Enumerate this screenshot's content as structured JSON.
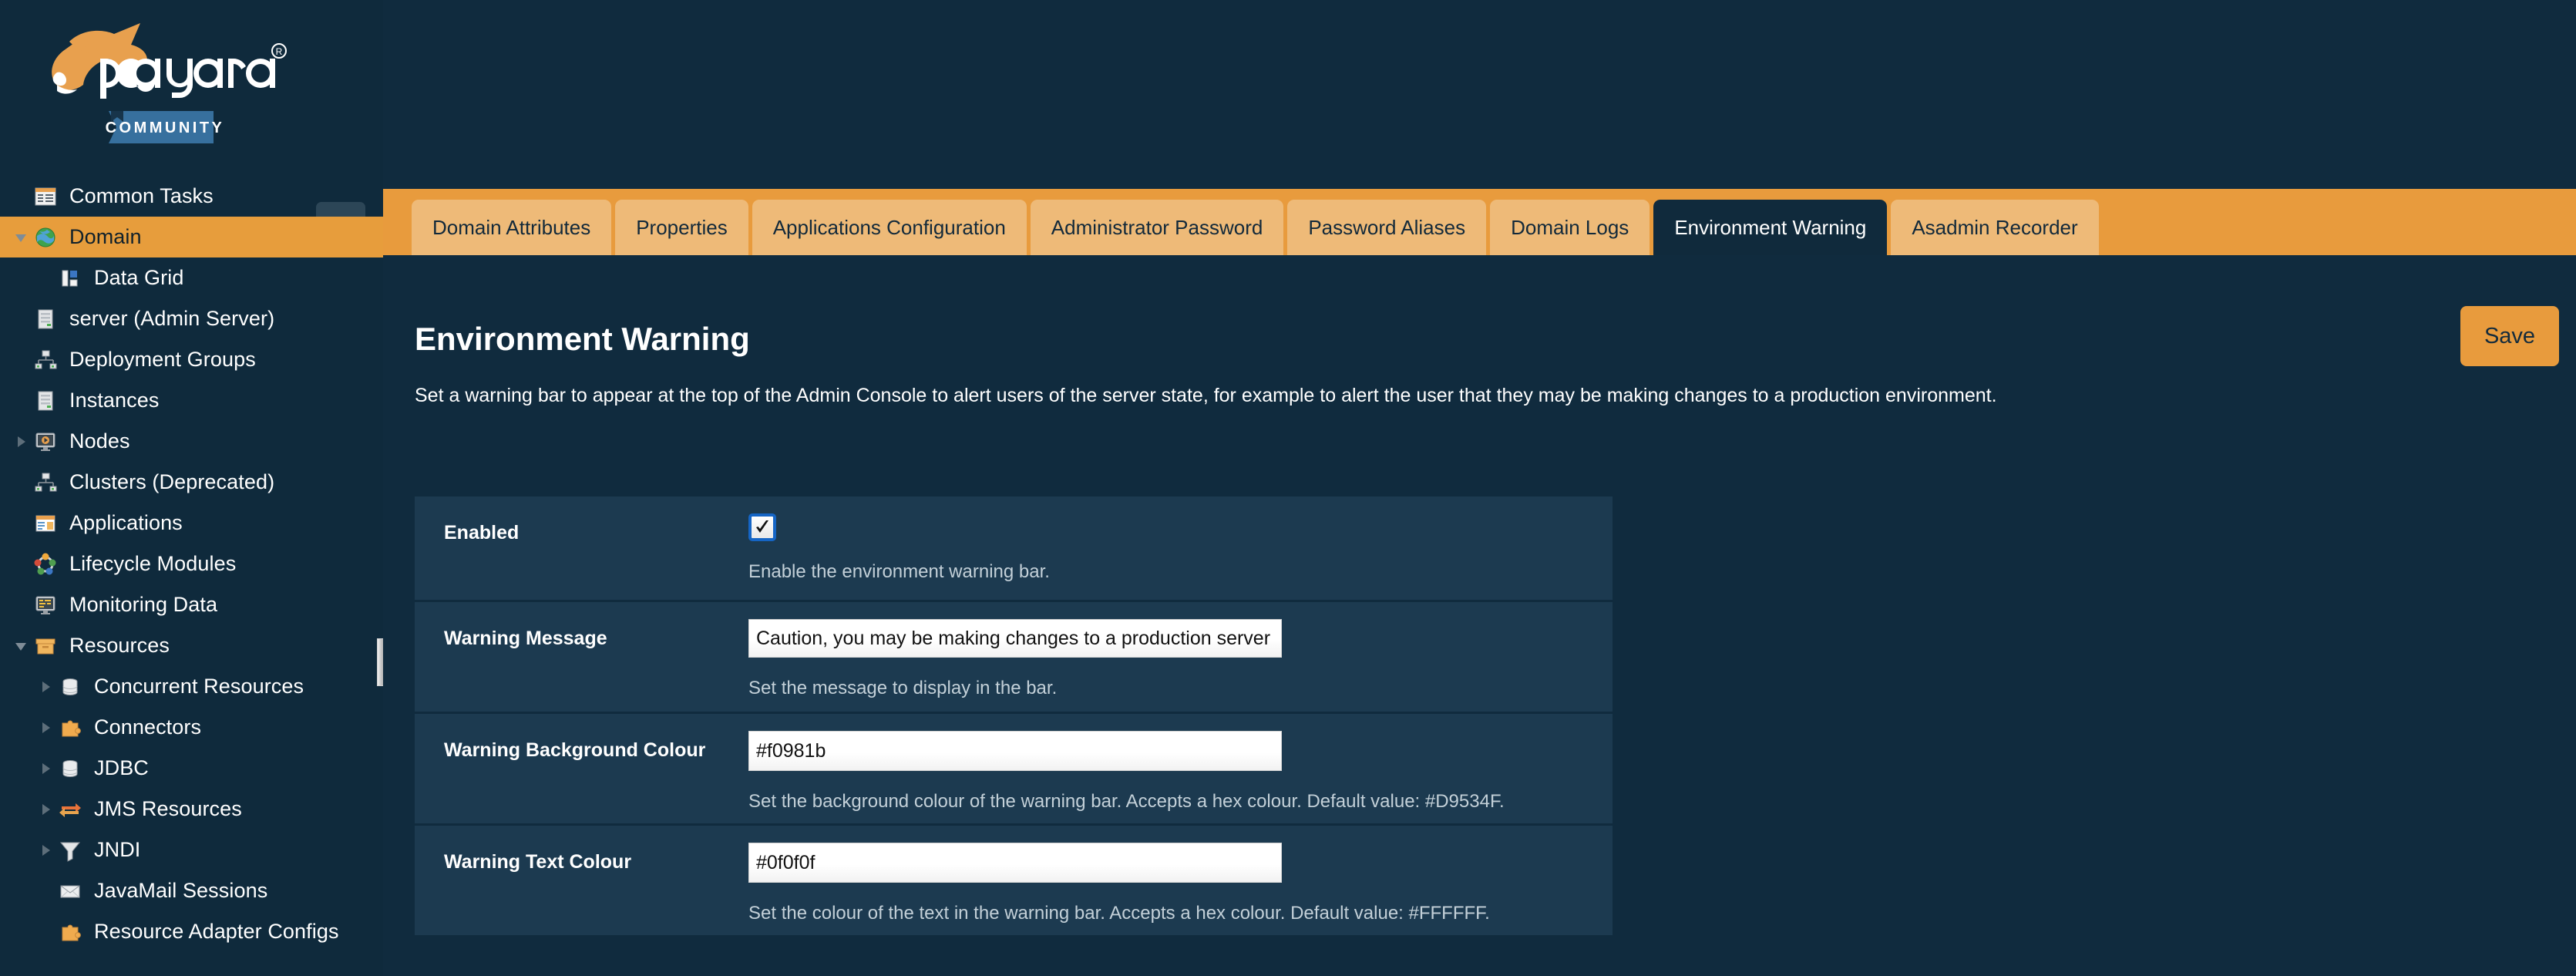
{
  "brand": {
    "name": "payara",
    "edition": "COMMUNITY",
    "registered_mark": "®"
  },
  "sidebar": {
    "collapse_icon": "double-chevron-left-icon",
    "items": [
      {
        "label": "Common Tasks",
        "icon": "common-tasks-icon",
        "twisty": "none",
        "indent": 0,
        "selected": false
      },
      {
        "label": "Domain",
        "icon": "globe-icon",
        "twisty": "down",
        "indent": 0,
        "selected": true
      },
      {
        "label": "Data Grid",
        "icon": "data-grid-icon",
        "twisty": "none",
        "indent": 1,
        "selected": false
      },
      {
        "label": "server (Admin Server)",
        "icon": "server-icon",
        "twisty": "none",
        "indent": 0,
        "selected": false
      },
      {
        "label": "Deployment Groups",
        "icon": "deployment-group-icon",
        "twisty": "none",
        "indent": 0,
        "selected": false
      },
      {
        "label": "Instances",
        "icon": "server-icon",
        "twisty": "none",
        "indent": 0,
        "selected": false
      },
      {
        "label": "Nodes",
        "icon": "node-monitor-icon",
        "twisty": "right",
        "indent": 0,
        "selected": false
      },
      {
        "label": "Clusters (Deprecated)",
        "icon": "cluster-icon",
        "twisty": "none",
        "indent": 0,
        "selected": false
      },
      {
        "label": "Applications",
        "icon": "applications-icon",
        "twisty": "none",
        "indent": 0,
        "selected": false
      },
      {
        "label": "Lifecycle Modules",
        "icon": "lifecycle-modules-icon",
        "twisty": "none",
        "indent": 0,
        "selected": false
      },
      {
        "label": "Monitoring Data",
        "icon": "monitoring-icon",
        "twisty": "none",
        "indent": 0,
        "selected": false
      },
      {
        "label": "Resources",
        "icon": "resources-box-icon",
        "twisty": "down",
        "indent": 0,
        "selected": false
      },
      {
        "label": "Concurrent Resources",
        "icon": "database-icon",
        "twisty": "right",
        "indent": 1,
        "selected": false
      },
      {
        "label": "Connectors",
        "icon": "puzzle-icon",
        "twisty": "right",
        "indent": 1,
        "selected": false
      },
      {
        "label": "JDBC",
        "icon": "database-icon",
        "twisty": "right",
        "indent": 1,
        "selected": false
      },
      {
        "label": "JMS Resources",
        "icon": "exchange-arrows-icon",
        "twisty": "right",
        "indent": 1,
        "selected": false
      },
      {
        "label": "JNDI",
        "icon": "funnel-icon",
        "twisty": "right",
        "indent": 1,
        "selected": false
      },
      {
        "label": "JavaMail Sessions",
        "icon": "envelope-icon",
        "twisty": "none",
        "indent": 1,
        "selected": false
      },
      {
        "label": "Resource Adapter Configs",
        "icon": "puzzle-icon",
        "twisty": "none",
        "indent": 1,
        "selected": false
      }
    ]
  },
  "tabs": [
    {
      "label": "Domain Attributes",
      "active": false
    },
    {
      "label": "Properties",
      "active": false
    },
    {
      "label": "Applications Configuration",
      "active": false
    },
    {
      "label": "Administrator Password",
      "active": false
    },
    {
      "label": "Password Aliases",
      "active": false
    },
    {
      "label": "Domain Logs",
      "active": false
    },
    {
      "label": "Environment Warning",
      "active": true
    },
    {
      "label": "Asadmin Recorder",
      "active": false
    }
  ],
  "page": {
    "title": "Environment Warning",
    "description": "Set a warning bar to appear at the top of the Admin Console to alert users of the server state, for example to alert the user that they may be making changes to a production environment.",
    "save_label": "Save"
  },
  "form": {
    "enabled": {
      "label": "Enabled",
      "checked": true,
      "help": "Enable the environment warning bar."
    },
    "warning_message": {
      "label": "Warning Message",
      "value": "Caution, you may be making changes to a production server",
      "help": "Set the message to display in the bar."
    },
    "background_colour": {
      "label": "Warning Background Colour",
      "value": "#f0981b",
      "help": "Set the background colour of the warning bar. Accepts a hex colour. Default value: #D9534F."
    },
    "text_colour": {
      "label": "Warning Text Colour",
      "value": "#0f0f0f",
      "help": "Set the colour of the text in the warning bar. Accepts a hex colour. Default value: #FFFFFF."
    }
  },
  "colors": {
    "page_background": "#102b3e",
    "sidebar_background": "#0f2a3c",
    "accent_orange": "#e89b3d",
    "tab_inactive": "#eeba78",
    "panel_row": "#1c3a50",
    "help_text": "#c3d0d8"
  }
}
